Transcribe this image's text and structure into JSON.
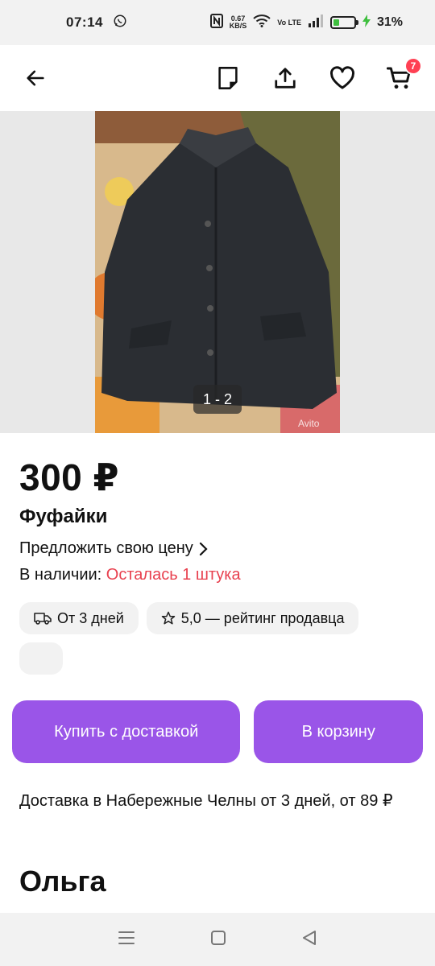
{
  "status": {
    "time": "07:14",
    "net_speed_value": "0.67",
    "net_speed_unit": "KB/S",
    "volte": "Vo LTE",
    "battery_pct": "31%",
    "battery_level": 0.31
  },
  "app_bar": {
    "cart_count": "7"
  },
  "gallery": {
    "counter": "1 - 2",
    "watermark": "Avito"
  },
  "product": {
    "price": "300 ₽",
    "title": "Фуфайки",
    "offer_label": "Предложить свою цену",
    "stock_label": "В наличии:",
    "stock_value": "Осталась 1 штука"
  },
  "chips": {
    "delivery": "От 3 дней",
    "rating": "5,0 — рейтинг продавца"
  },
  "actions": {
    "buy_label": "Купить с доставкой",
    "cart_label": "В корзину"
  },
  "delivery_info": "Доставка в Набережные Челны от 3 дней, от 89 ₽",
  "seller_name": "Ольга",
  "colors": {
    "accent": "#9a55e8",
    "stock_red": "#e8414f",
    "badge_red": "#ff4053"
  }
}
